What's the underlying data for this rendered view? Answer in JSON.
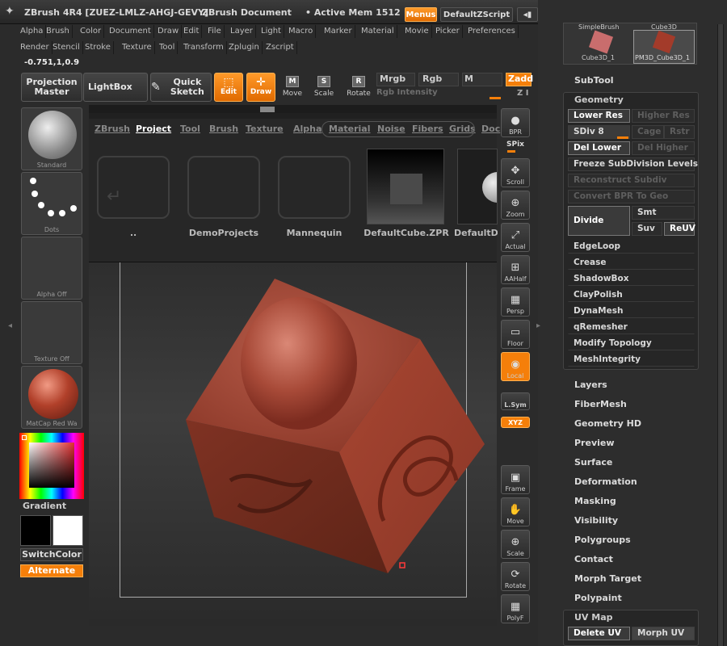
{
  "titlebar": {
    "app": "ZBrush 4R4 [ZUEZ-LMLZ-AHGJ-GEVY]",
    "doc": "ZBrush Document",
    "mem": "• Active Mem 1512",
    "menus": "Menus",
    "script": "DefaultZScript"
  },
  "menu1": [
    "Alpha",
    "Brush",
    "Color",
    "Document",
    "Draw",
    "Edit",
    "File",
    "Layer",
    "Light",
    "Macro",
    "Marker",
    "Material",
    "Movie",
    "Picker",
    "Preferences"
  ],
  "menu2": [
    "Render",
    "Stencil",
    "Stroke",
    "Texture",
    "Tool",
    "Transform",
    "Zplugin",
    "Zscript"
  ],
  "coords": "-0.751,1,0.9",
  "toolbar": {
    "projection": "Projection Master",
    "lightbox": "LightBox",
    "quick_sketch": "Quick Sketch",
    "edit": "Edit",
    "draw": "Draw",
    "move": "Move",
    "scale": "Scale",
    "rotate": "Rotate",
    "mrgb": "Mrgb",
    "rgb": "Rgb",
    "m": "M",
    "zadd": "Zadd",
    "zsub": "Z I",
    "rgb_intensity": "Rgb Intensity"
  },
  "lightbox": {
    "tabs": [
      "ZBrush",
      "Project",
      "Tool",
      "Brush",
      "Texture",
      "Alpha",
      "Material",
      "Noise",
      "Fibers",
      "Grids",
      "Doc"
    ],
    "active_tab": "Project",
    "items": [
      "..",
      "DemoProjects",
      "Mannequin",
      "DefaultCube.ZPR",
      "DefaultD"
    ]
  },
  "left": {
    "brush": "Standard",
    "stroke": "Dots",
    "alpha": "Alpha Off",
    "texture": "Texture Off",
    "material": "MatCap Red Wa",
    "gradient": "Gradient",
    "switchcolor": "SwitchColor",
    "alternate": "Alternate"
  },
  "rightshelf": [
    "BPR",
    "SPix",
    "Scroll",
    "Zoom",
    "Actual",
    "AAHalf",
    "Persp",
    "Floor",
    "Local",
    "L.Sym",
    "XYZ",
    "Frame",
    "Move",
    "Scale",
    "Rotate",
    "PolyF"
  ],
  "palette": {
    "tool_thumbs": [
      "SimpleBrush",
      "Cube3D",
      "Cube3D_1",
      "PM3D_Cube3D_1"
    ],
    "subtool": "SubTool",
    "geometry": "Geometry",
    "lower_res": "Lower Res",
    "higher_res": "Higher Res",
    "sdiv": "SDiv 8",
    "cage": "Cage",
    "rstr": "Rstr",
    "del_lower": "Del Lower",
    "del_higher": "Del Higher",
    "freeze": "Freeze SubDivision Levels",
    "reconstruct": "Reconstruct Subdiv",
    "convert": "Convert BPR To Geo",
    "divide": "Divide",
    "smt": "Smt",
    "suv": "Suv",
    "reuv": "ReUV",
    "geom_items": [
      "EdgeLoop",
      "Crease",
      "ShadowBox",
      "ClayPolish",
      "DynaMesh",
      "qRemesher",
      "Modify Topology",
      "MeshIntegrity"
    ],
    "sections": [
      "Layers",
      "FiberMesh",
      "Geometry HD",
      "Preview",
      "Surface",
      "Deformation",
      "Masking",
      "Visibility",
      "Polygroups",
      "Contact",
      "Morph Target",
      "Polypaint"
    ],
    "uvmap": "UV Map",
    "delete_uv": "Delete UV",
    "morph_uv": "Morph UV"
  },
  "colors": {
    "accent": "#f57f0a",
    "cube": "#8c3a2a"
  }
}
